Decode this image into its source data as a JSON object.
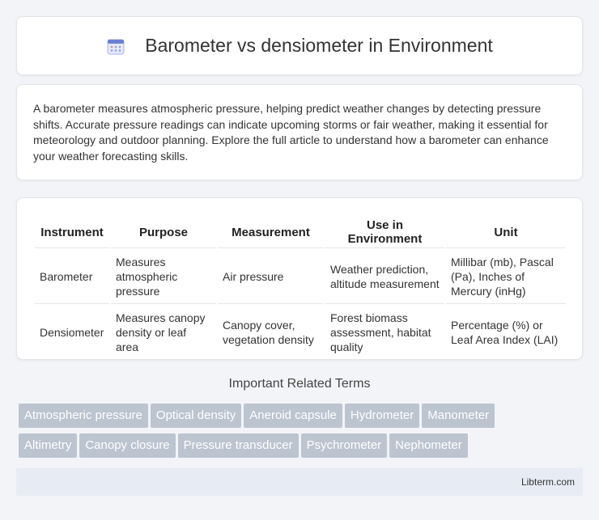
{
  "header": {
    "title": "Barometer vs densiometer in Environment",
    "icon": "calendar-icon"
  },
  "intro": {
    "text": "A barometer measures atmospheric pressure, helping predict weather changes by detecting pressure shifts. Accurate pressure readings can indicate upcoming storms or fair weather, making it essential for meteorology and outdoor planning. Explore the full article to understand how a barometer can enhance your weather forecasting skills."
  },
  "table": {
    "headers": [
      "Instrument",
      "Purpose",
      "Measurement",
      "Use in Environment",
      "Unit"
    ],
    "rows": [
      [
        "Barometer",
        "Measures atmospheric pressure",
        "Air pressure",
        "Weather prediction, altitude measurement",
        "Millibar (mb), Pascal (Pa), Inches of Mercury (inHg)"
      ],
      [
        "Densiometer",
        "Measures canopy density or leaf area",
        "Canopy cover, vegetation density",
        "Forest biomass assessment, habitat quality",
        "Percentage (%) or Leaf Area Index (LAI)"
      ]
    ]
  },
  "related": {
    "title": "Important Related Terms",
    "tags": [
      "Atmospheric pressure",
      "Optical density",
      "Aneroid capsule",
      "Hydrometer",
      "Manometer",
      "Altimetry",
      "Canopy closure",
      "Pressure transducer",
      "Psychrometer",
      "Nephometer"
    ]
  },
  "footer": {
    "text": "Libterm.com"
  },
  "colors": {
    "background": "#f2f4f7",
    "tag": "#bcc4d0",
    "footer": "#e7ebf3",
    "icon_accent": "#6b7fd6"
  }
}
